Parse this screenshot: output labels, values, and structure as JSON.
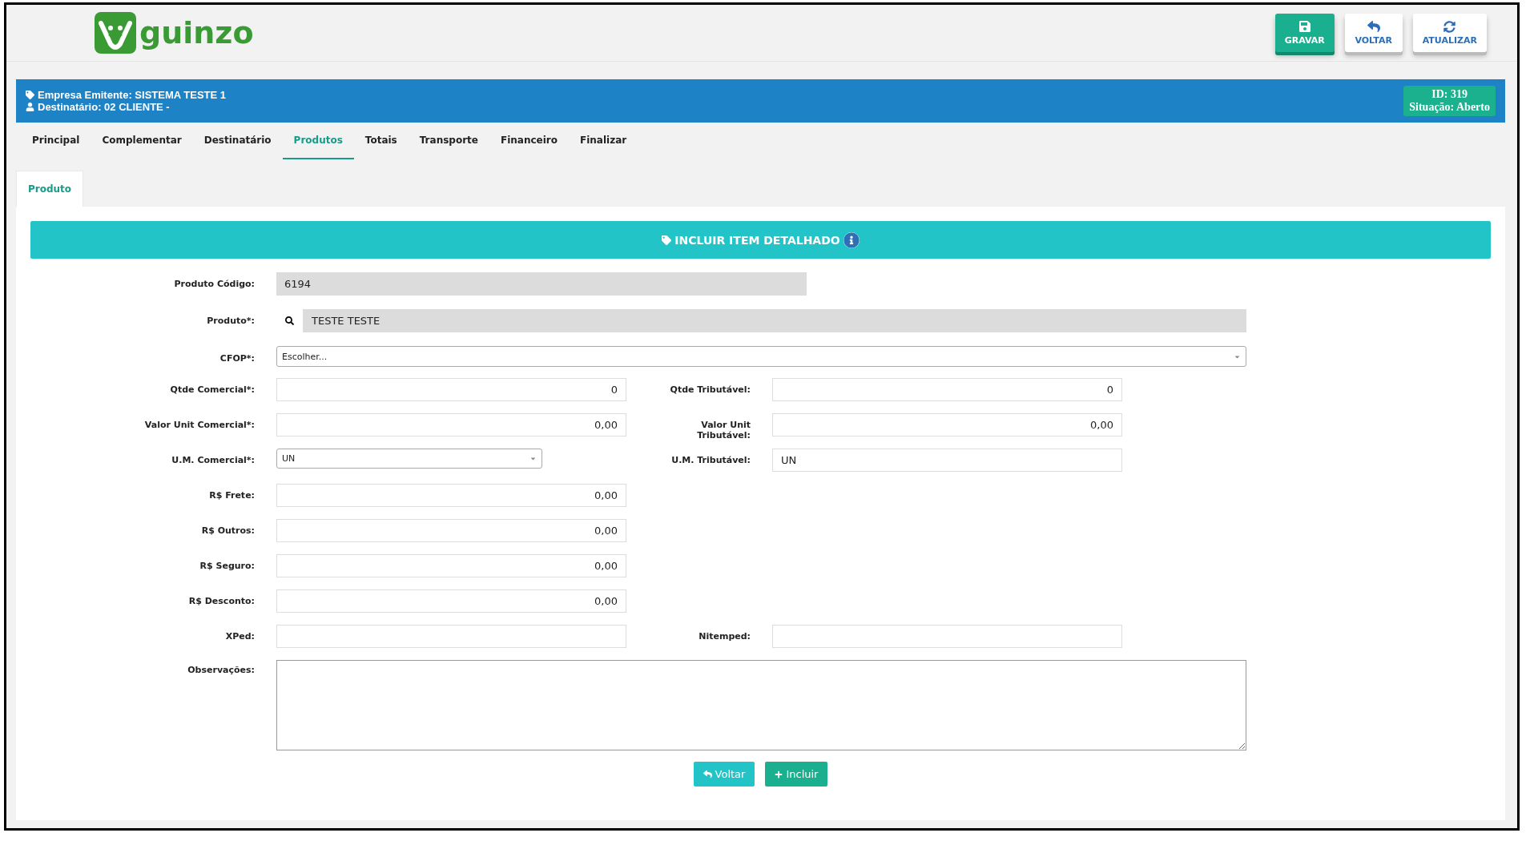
{
  "logo": {
    "text": "guinzo"
  },
  "toolbar": [
    {
      "label": "GRAVAR",
      "kind": "save"
    },
    {
      "label": "VOLTAR",
      "kind": "back"
    },
    {
      "label": "ATUALIZAR",
      "kind": "refresh"
    }
  ],
  "info_bar": {
    "emitter": "Empresa Emitente: SISTEMA TESTE 1",
    "recipient": "Destinatário: 02 CLIENTE -",
    "id": "ID: 319",
    "status": "Situação: Aberto"
  },
  "tabs": [
    {
      "label": "Principal",
      "selected": false
    },
    {
      "label": "Complementar",
      "selected": false
    },
    {
      "label": "Destinatário",
      "selected": false
    },
    {
      "label": "Produtos",
      "selected": true
    },
    {
      "label": "Totais",
      "selected": false
    },
    {
      "label": "Transporte",
      "selected": false
    },
    {
      "label": "Financeiro",
      "selected": false
    },
    {
      "label": "Finalizar",
      "selected": false
    }
  ],
  "subtabs": [
    {
      "label": "Produto",
      "selected": true
    }
  ],
  "section_title": "INCLUIR ITEM DETALHADO",
  "rows": [
    {
      "fields": [
        {
          "label": "Produto Código:",
          "kind": "readonly",
          "value": "6194"
        }
      ]
    },
    {
      "fields": [
        {
          "label": "Produto*:",
          "kind": "lookup",
          "value": "TESTE TESTE"
        }
      ]
    },
    {
      "fields": [
        {
          "label": "CFOP*:",
          "kind": "wide-select",
          "value": "Escolher..."
        }
      ]
    },
    {
      "fields": [
        {
          "label": "Qtde Comercial*:",
          "kind": "number",
          "value": "0"
        },
        {
          "label": "Qtde Tributável:",
          "kind": "number",
          "value": "0"
        }
      ]
    },
    {
      "fields": [
        {
          "label": "Valor Unit Comercial*:",
          "kind": "number",
          "value": "0,00"
        },
        {
          "label": "Valor Unit Tributável:",
          "kind": "number",
          "value": "0,00"
        }
      ]
    },
    {
      "fields": [
        {
          "label": "U.M. Comercial*:",
          "kind": "select",
          "value": "UN"
        },
        {
          "label": "U.M. Tributável:",
          "kind": "text",
          "value": "UN"
        }
      ]
    },
    {
      "fields": [
        {
          "label": "R$ Frete:",
          "kind": "number",
          "value": "0,00"
        }
      ]
    },
    {
      "fields": [
        {
          "label": "R$ Outros:",
          "kind": "number",
          "value": "0,00"
        }
      ]
    },
    {
      "fields": [
        {
          "label": "R$ Seguro:",
          "kind": "number",
          "value": "0,00"
        }
      ]
    },
    {
      "fields": [
        {
          "label": "R$ Desconto:",
          "kind": "number",
          "value": "0,00"
        }
      ]
    },
    {
      "fields": [
        {
          "label": "XPed:",
          "kind": "text"
        },
        {
          "label": "Nitemped:",
          "kind": "text"
        }
      ]
    },
    {
      "fields": [
        {
          "label": "Observações:",
          "kind": "textarea"
        }
      ]
    }
  ],
  "actions": [
    {
      "label": "Voltar",
      "kind": "back"
    },
    {
      "label": "Incluir",
      "kind": "add"
    }
  ]
}
